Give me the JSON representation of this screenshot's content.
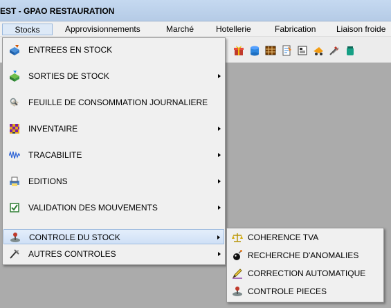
{
  "window": {
    "title": "EST - GPAO RESTAURATION"
  },
  "menubar": {
    "items": [
      {
        "label": "Stocks"
      },
      {
        "label": "Approvisionnements"
      },
      {
        "label": "Marché"
      },
      {
        "label": "Hotellerie"
      },
      {
        "label": "Fabrication"
      },
      {
        "label": "Liaison froide"
      }
    ]
  },
  "toolbar": {
    "icons": [
      "gift-icon",
      "cylinder-icon",
      "grid-icon",
      "notebook-icon",
      "form-icon",
      "truck-icon",
      "tools-icon",
      "jar-icon"
    ]
  },
  "stocks_menu": {
    "items": [
      {
        "label": "ENTREES EN STOCK",
        "icon": "box-in-icon",
        "has_submenu": false
      },
      {
        "label": "SORTIES DE STOCK",
        "icon": "box-out-icon",
        "has_submenu": true
      },
      {
        "label": "FEUILLE DE CONSOMMATION JOURNALIERE",
        "icon": "magnifier-icon",
        "has_submenu": false
      },
      {
        "label": "INVENTAIRE",
        "icon": "checkers-icon",
        "has_submenu": true
      },
      {
        "label": "TRACABILITE",
        "icon": "wave-icon",
        "has_submenu": true
      },
      {
        "label": "EDITIONS",
        "icon": "printer-icon",
        "has_submenu": true
      },
      {
        "label": "VALIDATION DES MOUVEMENTS",
        "icon": "checkbox-icon",
        "has_submenu": true
      },
      {
        "label": "CONTROLE DU STOCK",
        "icon": "joystick-icon",
        "has_submenu": true,
        "highlighted": true
      },
      {
        "label": "AUTRES CONTROLES",
        "icon": "tools-icon",
        "has_submenu": true
      }
    ]
  },
  "controle_submenu": {
    "items": [
      {
        "label": "COHERENCE TVA",
        "icon": "scale-icon"
      },
      {
        "label": "RECHERCHE D'ANOMALIES",
        "icon": "bomb-icon"
      },
      {
        "label": "CORRECTION AUTOMATIQUE",
        "icon": "pencil-icon"
      },
      {
        "label": "CONTROLE PIECES",
        "icon": "joystick-icon"
      }
    ]
  },
  "colors": {
    "titlebar": "#c5d9f0",
    "menu_bg": "#f0f0f0",
    "highlight": "#cfe0f6",
    "workspace": "#ababab"
  }
}
